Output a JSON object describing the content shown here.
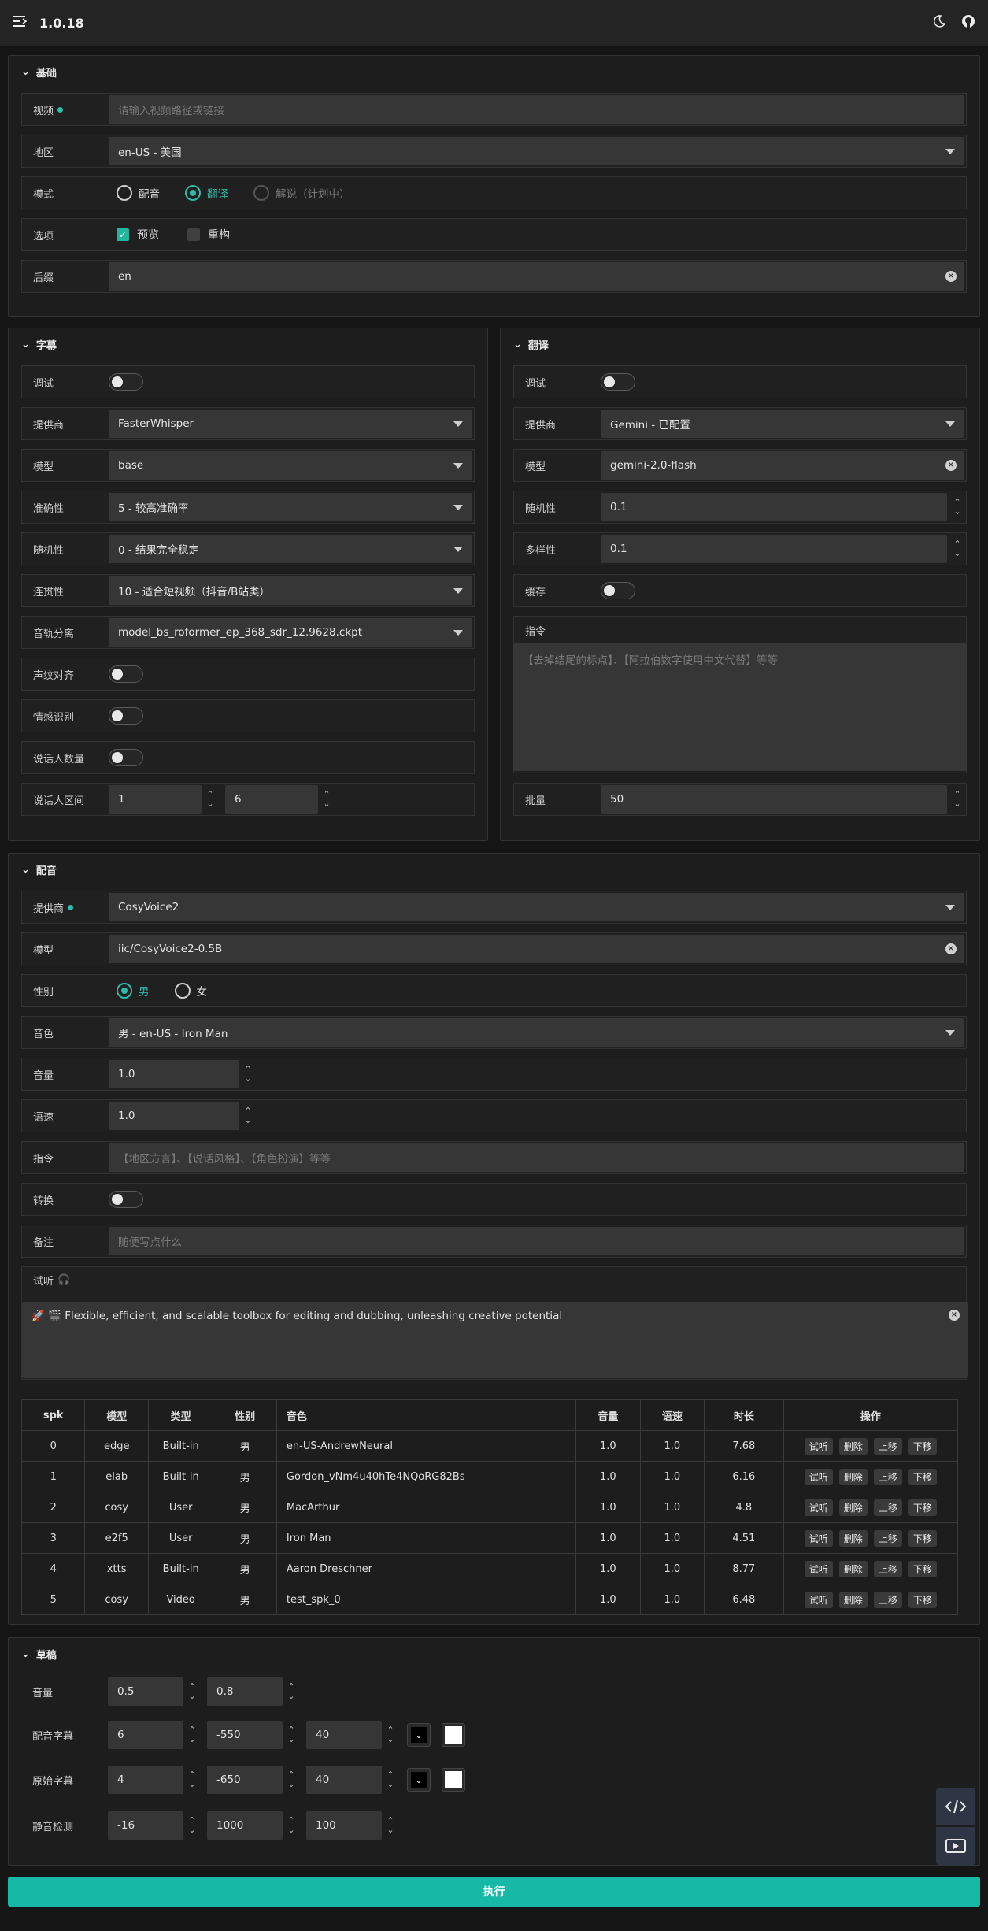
{
  "app": {
    "version": "1.0.18"
  },
  "basic": {
    "title": "基础",
    "video_label": "视频",
    "video_placeholder": "请输入视频路径或链接",
    "region_label": "地区",
    "region_value": "en-US - 美国",
    "mode_label": "模式",
    "mode_options": [
      "配音",
      "翻译",
      "解说（计划中）"
    ],
    "options_label": "选项",
    "opt_preview": "预览",
    "opt_rebuild": "重构",
    "suffix_label": "后缀",
    "suffix_value": "en"
  },
  "subtitle": {
    "title": "字幕",
    "debug_label": "调试",
    "provider_label": "提供商",
    "provider_value": "FasterWhisper",
    "model_label": "模型",
    "model_value": "base",
    "accuracy_label": "准确性",
    "accuracy_value": "5 - 较高准确率",
    "randomness_label": "随机性",
    "randomness_value": "0 - 结果完全稳定",
    "coherence_label": "连贯性",
    "coherence_value": "10 - 适合短视频（抖音/B站类）",
    "separation_label": "音轨分离",
    "separation_value": "model_bs_roformer_ep_368_sdr_12.9628.ckpt",
    "voiceprint_label": "声纹对齐",
    "emotion_label": "情感识别",
    "speakers_label": "说话人数量",
    "range_label": "说话人区间",
    "range_min": "1",
    "range_max": "6"
  },
  "translation": {
    "title": "翻译",
    "debug_label": "调试",
    "provider_label": "提供商",
    "provider_value": "Gemini - 已配置",
    "model_label": "模型",
    "model_value": "gemini-2.0-flash",
    "randomness_label": "随机性",
    "randomness_value": "0.1",
    "diversity_label": "多样性",
    "diversity_value": "0.1",
    "cache_label": "缓存",
    "instruction_label": "指令",
    "instruction_placeholder": "【去掉结尾的标点】、【阿拉伯数字使用中文代替】等等",
    "batch_label": "批量",
    "batch_value": "50"
  },
  "dubbing": {
    "title": "配音",
    "provider_label": "提供商",
    "provider_value": "CosyVoice2",
    "model_label": "模型",
    "model_value": "iic/CosyVoice2-0.5B",
    "gender_label": "性别",
    "gender_male": "男",
    "gender_female": "女",
    "voice_label": "音色",
    "voice_value": "男 - en-US - Iron Man",
    "volume_label": "音量",
    "volume_value": "1.0",
    "speed_label": "语速",
    "speed_value": "1.0",
    "instruction_label": "指令",
    "instruction_placeholder": "【地区方言】、【说话风格】、【角色扮演】等等",
    "convert_label": "转换",
    "notes_label": "备注",
    "notes_placeholder": "随便写点什么",
    "preview_label": "试听",
    "preview_text": "🚀 🎬 Flexible, efficient, and scalable toolbox for editing and dubbing, unleashing creative potential",
    "table": {
      "headers": [
        "spk",
        "模型",
        "类型",
        "性别",
        "音色",
        "音量",
        "语速",
        "时长",
        "操作"
      ],
      "rows": [
        [
          "0",
          "edge",
          "Built-in",
          "男",
          "en-US-AndrewNeural",
          "1.0",
          "1.0",
          "7.68"
        ],
        [
          "1",
          "elab",
          "Built-in",
          "男",
          "Gordon_vNm4u40hTe4NQoRG82Bs",
          "1.0",
          "1.0",
          "6.16"
        ],
        [
          "2",
          "cosy",
          "User",
          "男",
          "MacArthur",
          "1.0",
          "1.0",
          "4.8"
        ],
        [
          "3",
          "e2f5",
          "User",
          "男",
          "Iron Man",
          "1.0",
          "1.0",
          "4.51"
        ],
        [
          "4",
          "xtts",
          "Built-in",
          "男",
          "Aaron Dreschner",
          "1.0",
          "1.0",
          "8.77"
        ],
        [
          "5",
          "cosy",
          "Video",
          "男",
          "test_spk_0",
          "1.0",
          "1.0",
          "6.48"
        ]
      ],
      "ops": [
        "试听",
        "删除",
        "上移",
        "下移"
      ]
    }
  },
  "draft": {
    "title": "草稿",
    "volume_label": "音量",
    "volume_values": [
      "0.5",
      "0.8"
    ],
    "dub_sub_label": "配音字幕",
    "dub_sub_values": [
      "6",
      "-550",
      "40"
    ],
    "orig_sub_label": "原始字幕",
    "orig_sub_values": [
      "4",
      "-650",
      "40"
    ],
    "silence_label": "静音检测",
    "silence_values": [
      "-16",
      "1000",
      "100"
    ]
  },
  "execute_label": "执行",
  "colors": {
    "accent": "#15b9a5",
    "panel": "#1d1d1d",
    "input": "#363636"
  }
}
